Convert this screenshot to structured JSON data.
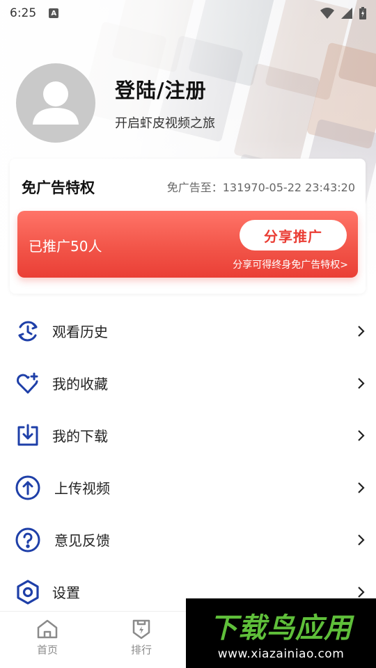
{
  "status_bar": {
    "time": "6:25",
    "notification_badge": "A"
  },
  "profile": {
    "title": "登陆/注册",
    "subtitle": "开启虾皮视频之旅"
  },
  "ad_card": {
    "title": "免广告特权",
    "expire_text": "免广告至：131970-05-22 23:43:20",
    "promo_count": "已推广50人",
    "share_button": "分享推广",
    "promo_hint": "分享可得终身免广告特权>"
  },
  "menu": [
    {
      "label": "观看历史",
      "icon": "history-icon"
    },
    {
      "label": "我的收藏",
      "icon": "favorite-heart-icon"
    },
    {
      "label": "我的下载",
      "icon": "download-icon"
    },
    {
      "label": "上传视频",
      "icon": "upload-icon"
    },
    {
      "label": "意见反馈",
      "icon": "feedback-question-icon"
    },
    {
      "label": "设置",
      "icon": "settings-icon"
    }
  ],
  "bottom_nav": [
    {
      "label": "首页",
      "icon": "home-icon"
    },
    {
      "label": "排行",
      "icon": "rank-badge-icon"
    }
  ],
  "watermark": {
    "title": "下载鸟应用",
    "url": "www.xiazainiao.com"
  },
  "colors": {
    "accent_blue": "#1e3fa8",
    "promo_red": "#ea3f36",
    "watermark_green": "#5fbf3a"
  }
}
